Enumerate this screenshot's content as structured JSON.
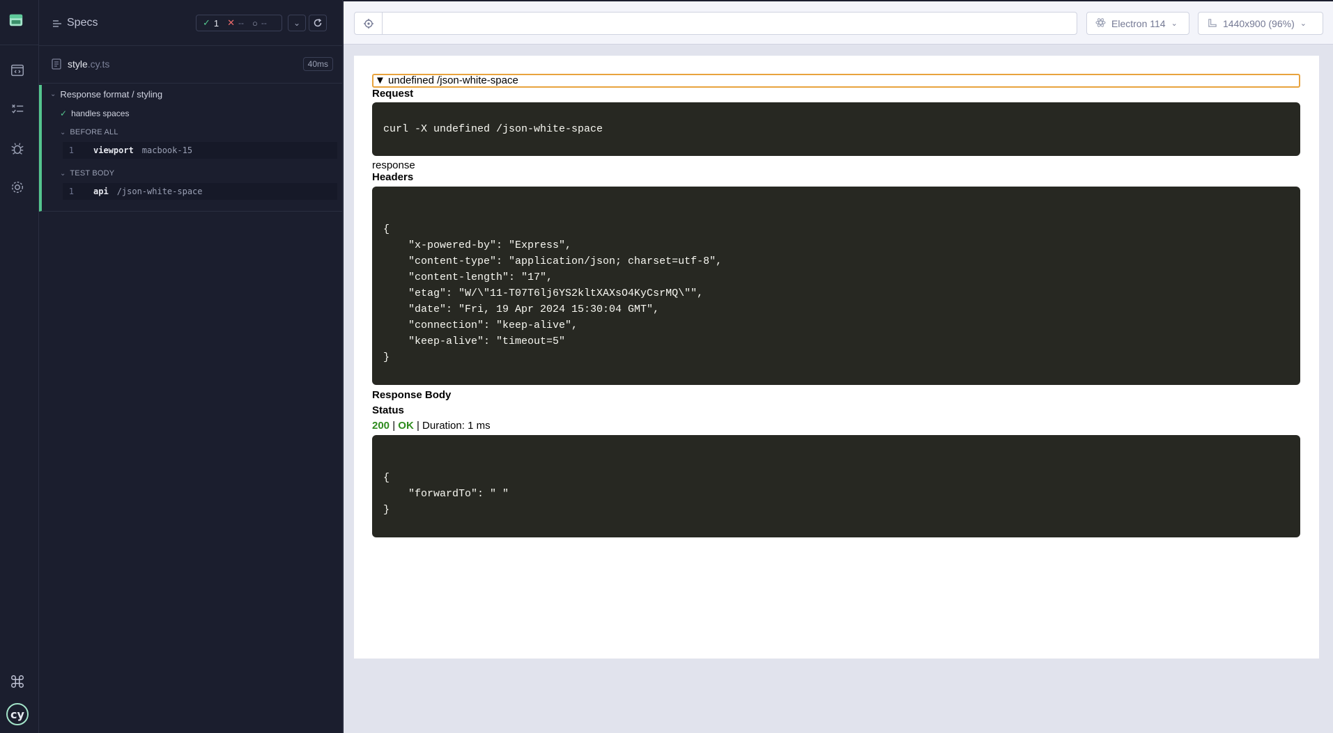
{
  "colors": {
    "pass": "#54c58e",
    "fail": "#f06c6c",
    "highlight_border": "#e8a33d",
    "code_bg": "#272822",
    "status_ok": "#2e8b1e"
  },
  "nav": {
    "items": [
      "app-logo-icon",
      "specs-icon",
      "runs-icon",
      "debug-icon",
      "settings-icon",
      "keyboard-shortcuts-icon",
      "cypress-logo-icon"
    ]
  },
  "reporter": {
    "title": "Specs",
    "stats": {
      "passed": "1",
      "failed": "--",
      "pending": "--"
    },
    "spec": {
      "name": "style",
      "ext": ".cy.ts",
      "duration": "40ms"
    },
    "suite": "Response format / styling",
    "test": "handles spaces",
    "before_all_label": "BEFORE ALL",
    "before_all_cmd": {
      "index": "1",
      "name": "viewport",
      "arg": "macbook-15"
    },
    "test_body_label": "TEST BODY",
    "test_body_cmd": {
      "index": "1",
      "name": "api",
      "arg": "/json-white-space"
    }
  },
  "toolbar": {
    "url": "",
    "browser": "Electron 114",
    "viewport": "1440x900 (96%)"
  },
  "aut": {
    "summary": "▼ undefined /json-white-space",
    "request_label": "Request",
    "request_code": "curl -X undefined /json-white-space",
    "response_label": "response",
    "headers_label": "Headers",
    "headers_code": "{\n    \"x-powered-by\": \"Express\",\n    \"content-type\": \"application/json; charset=utf-8\",\n    \"content-length\": \"17\",\n    \"etag\": \"W/\\\"11-T07T6lj6YS2kltXAXsO4KyCsrMQ\\\"\",\n    \"date\": \"Fri, 19 Apr 2024 15:30:04 GMT\",\n    \"connection\": \"keep-alive\",\n    \"keep-alive\": \"timeout=5\"\n}",
    "body_label": "Response Body",
    "status_label": "Status",
    "status_code": "200",
    "sep1": "|",
    "status_text": "OK",
    "sep2": "|",
    "duration": "Duration: 1 ms",
    "body_code": "{\n    \"forwardTo\": \" \"\n}"
  }
}
